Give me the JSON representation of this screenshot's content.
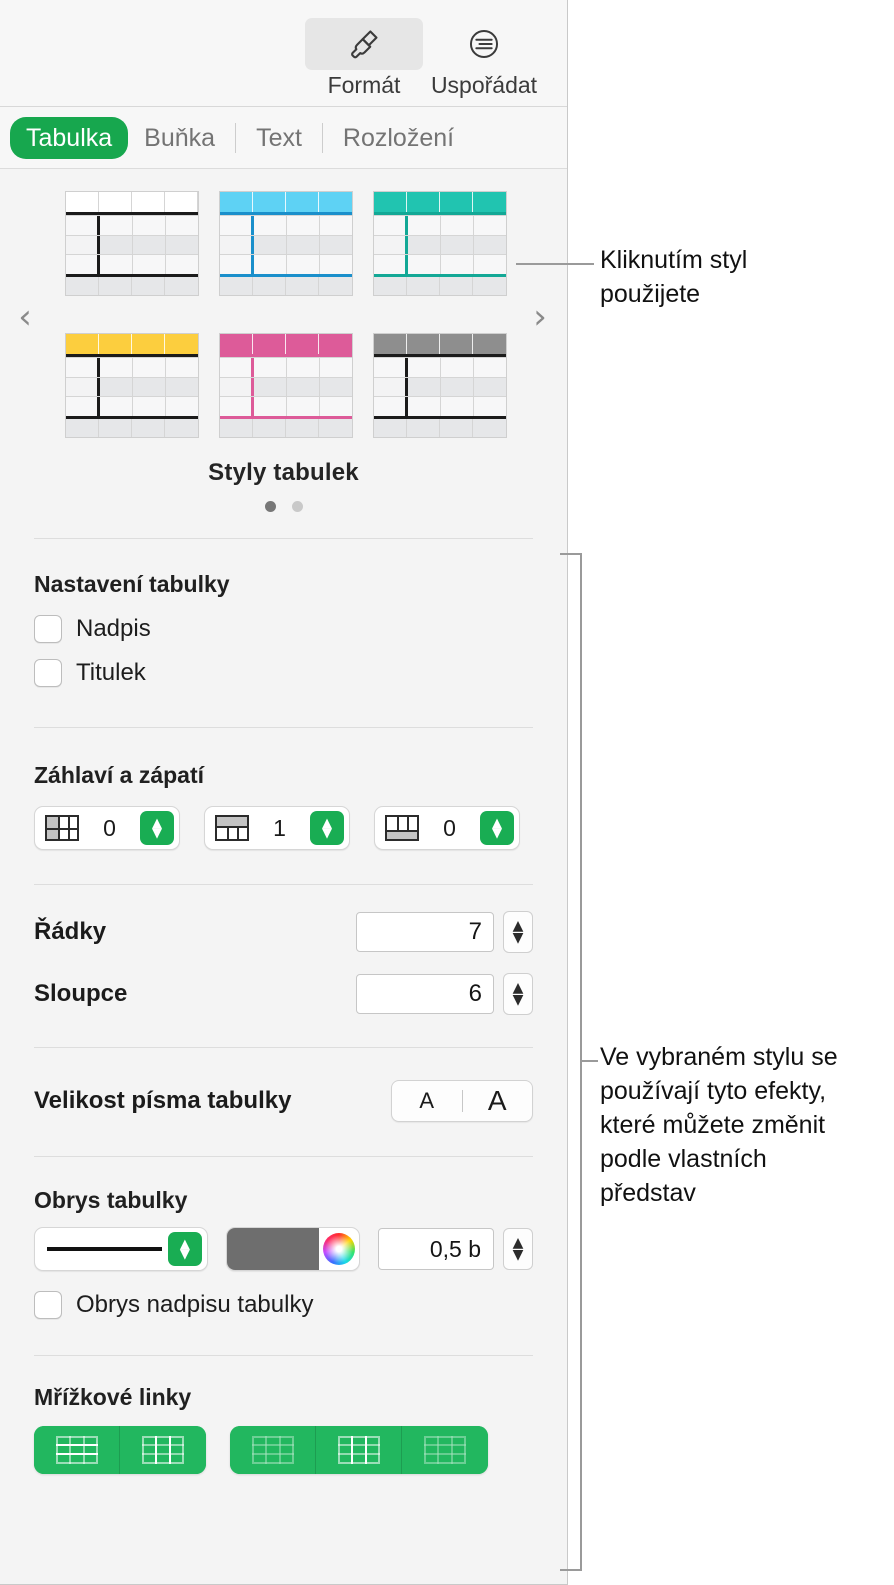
{
  "toolbar": {
    "format": {
      "label": "Formát",
      "icon": "paintbrush-icon",
      "selected": true
    },
    "arrange": {
      "label": "Uspořádat",
      "icon": "align-icon",
      "selected": false
    }
  },
  "tabs": [
    {
      "label": "Tabulka",
      "active": true
    },
    {
      "label": "Buňka",
      "active": false
    },
    {
      "label": "Text",
      "active": false
    },
    {
      "label": "Rozložení",
      "active": false
    }
  ],
  "style_browser": {
    "title": "Styly tabulek",
    "prev_icon": "chevron-left-icon",
    "next_icon": "chevron-right-icon",
    "page_dots": [
      {
        "active": true
      },
      {
        "active": false
      }
    ],
    "styles": [
      {
        "name": "plain-black",
        "header_color": "#ffffff",
        "accent": "#1b1b1b",
        "header_white": true
      },
      {
        "name": "light-blue",
        "header_color": "#5ed2f4",
        "accent": "#1a8fcb",
        "header_white": false
      },
      {
        "name": "teal",
        "header_color": "#21c4b0",
        "accent": "#13a896",
        "header_white": false
      },
      {
        "name": "yellow",
        "header_color": "#fcce3e",
        "accent": "#1b1b1b",
        "header_white": false
      },
      {
        "name": "pink",
        "header_color": "#dd5b99",
        "accent": "#dd5b99",
        "header_white": false
      },
      {
        "name": "gray",
        "header_color": "#8e8e8e",
        "accent": "#1b1b1b",
        "header_white": false
      }
    ]
  },
  "table_settings": {
    "title": "Nastavení tabulky",
    "checkboxes": [
      {
        "label": "Nadpis",
        "checked": false
      },
      {
        "label": "Titulek",
        "checked": false
      }
    ]
  },
  "headers_footers": {
    "title": "Záhlaví a zápatí",
    "steppers": [
      {
        "icon": "header-columns-icon",
        "value": "0"
      },
      {
        "icon": "header-rows-icon",
        "value": "1"
      },
      {
        "icon": "footer-rows-icon",
        "value": "0"
      }
    ]
  },
  "dimensions": {
    "rows": {
      "label": "Řádky",
      "value": "7"
    },
    "columns": {
      "label": "Sloupce",
      "value": "6"
    }
  },
  "font_size": {
    "label": "Velikost písma tabulky",
    "decrease": "A",
    "increase": "A"
  },
  "table_outline": {
    "title": "Obrys tabulky",
    "stroke_style": "solid-line",
    "color": "#6e6e6e",
    "width": "0,5 b",
    "checkbox": {
      "label": "Obrys nadpisu tabulky",
      "checked": false
    }
  },
  "gridlines": {
    "title": "Mřížkové linky",
    "group_one": [
      {
        "icon": "horizontal-gridlines-icon",
        "active": true
      },
      {
        "icon": "vertical-gridlines-icon",
        "active": true
      }
    ],
    "group_two": [
      {
        "icon": "header-horizontal-gridlines-icon",
        "active": false
      },
      {
        "icon": "header-vertical-gridlines-icon",
        "active": true
      },
      {
        "icon": "footer-gridlines-icon",
        "active": false
      }
    ]
  },
  "callouts": [
    {
      "text": "Kliknutím styl\npoužijete"
    },
    {
      "text": "Ve vybraném stylu se\npoužívají tyto efekty,\nkteré můžete změnit\npodle vlastních\npředstav"
    }
  ]
}
